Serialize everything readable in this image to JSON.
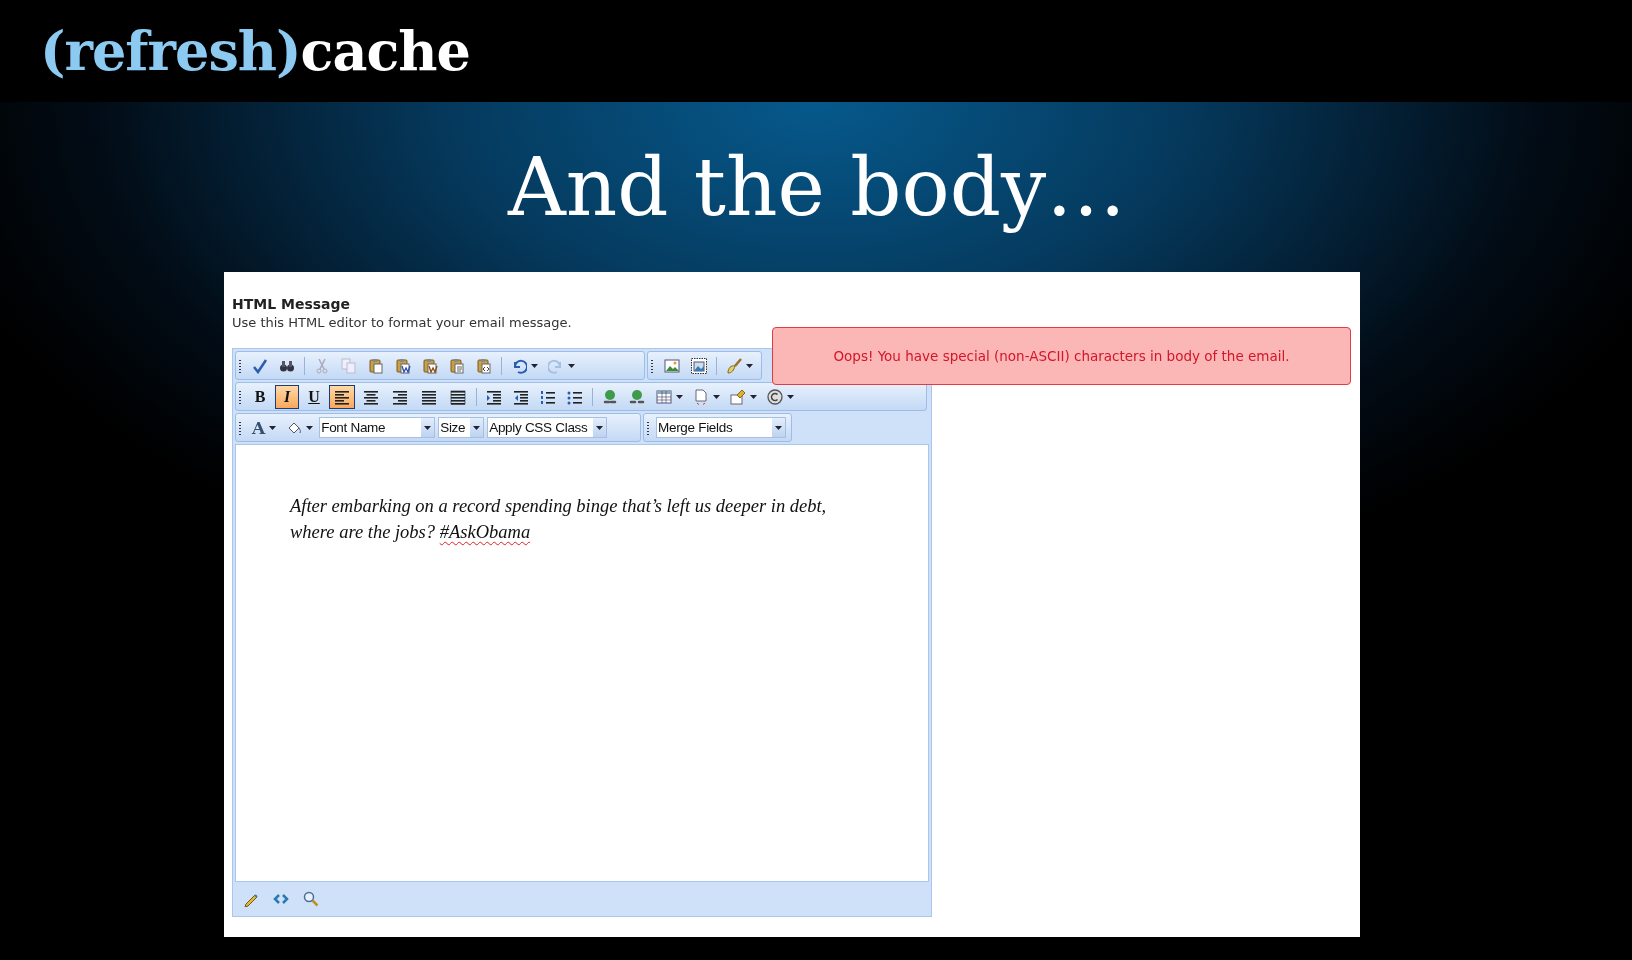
{
  "logo": {
    "prefix": "(refresh)",
    "wordmark": "cache"
  },
  "slide_title": "And the body…",
  "section": {
    "title": "HTML Message",
    "description": "Use this HTML editor to format your email message."
  },
  "alert": {
    "text": "Oops! You have special (non-ASCII) characters in body of the email."
  },
  "format_buttons": [
    {
      "label": "B",
      "kind": "bold",
      "on": false
    },
    {
      "label": "I",
      "kind": "italic",
      "on": true
    },
    {
      "label": "U",
      "kind": "underline",
      "on": false
    }
  ],
  "align_buttons": [
    {
      "on": true
    },
    {
      "on": false
    },
    {
      "on": false
    },
    {
      "on": false
    },
    {
      "on": false
    }
  ],
  "font_color_glyph": "A",
  "dropdowns": [
    {
      "label": "Font Name",
      "kind": "wide"
    },
    {
      "label": "Size",
      "kind": "narrow"
    },
    {
      "label": "Apply CSS Class",
      "kind": "medium"
    }
  ],
  "merge_fields": {
    "label": "Merge Fields"
  },
  "body": {
    "text": "After embarking on a record spending binge that’s left us deeper in debt, where are the jobs?",
    "hashtag": "#AskObama",
    "hashtag_misspelled": true
  }
}
